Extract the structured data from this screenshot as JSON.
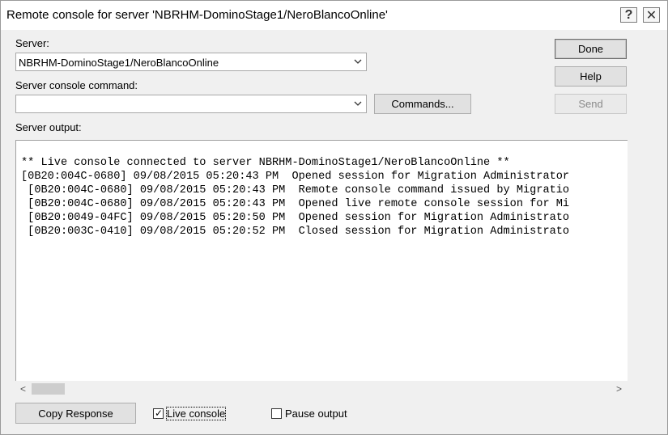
{
  "window": {
    "title": "Remote console for server 'NBRHM-DominoStage1/NeroBlancoOnline'",
    "help_glyph": "?",
    "close_glyph": "✕"
  },
  "form": {
    "server_label": "Server:",
    "server_value": "NBRHM-DominoStage1/NeroBlancoOnline",
    "command_label": "Server console command:",
    "command_value": "",
    "commands_button": "Commands...",
    "output_label": "Server output:"
  },
  "buttons": {
    "done": "Done",
    "help": "Help",
    "send": "Send",
    "copy_response": "Copy Response"
  },
  "output": {
    "lines": [
      "** Live console connected to server NBRHM-DominoStage1/NeroBlancoOnline **",
      "[0B20:004C-0680] 09/08/2015 05:20:43 PM  Opened session for Migration Administrator",
      " [0B20:004C-0680] 09/08/2015 05:20:43 PM  Remote console command issued by Migratio",
      " [0B20:004C-0680] 09/08/2015 05:20:43 PM  Opened live remote console session for Mi",
      " [0B20:0049-04FC] 09/08/2015 05:20:50 PM  Opened session for Migration Administrato",
      " [0B20:003C-0410] 09/08/2015 05:20:52 PM  Closed session for Migration Administrato"
    ]
  },
  "scrollbar": {
    "left_arrow": "<",
    "right_arrow": ">"
  },
  "options": {
    "live_console_label": "Live console",
    "live_console_checked": true,
    "pause_output_label": "Pause output",
    "pause_output_checked": false
  },
  "icons": {
    "dropdown": "chevron-down-icon",
    "help": "help-icon",
    "close": "close-icon"
  }
}
